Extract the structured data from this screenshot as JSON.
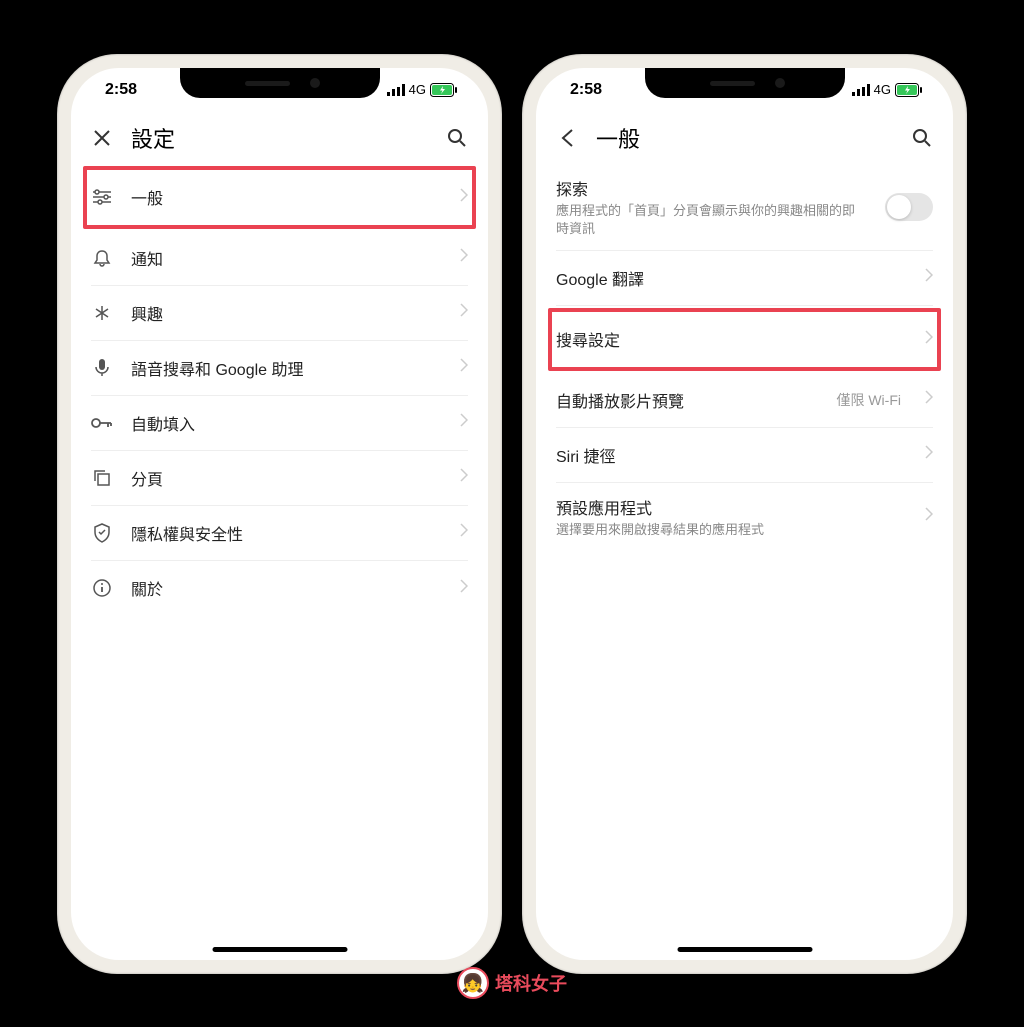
{
  "status": {
    "time": "2:58",
    "network": "4G"
  },
  "left": {
    "header": {
      "title": "設定"
    },
    "rows": [
      {
        "icon": "sliders",
        "label": "一般",
        "highlight": true
      },
      {
        "icon": "bell",
        "label": "通知"
      },
      {
        "icon": "star",
        "label": "興趣"
      },
      {
        "icon": "mic",
        "label": "語音搜尋和 Google 助理"
      },
      {
        "icon": "key",
        "label": "自動填入"
      },
      {
        "icon": "copy",
        "label": "分頁"
      },
      {
        "icon": "shield",
        "label": "隱私權與安全性"
      },
      {
        "icon": "info",
        "label": "關於"
      }
    ]
  },
  "right": {
    "header": {
      "title": "一般"
    },
    "rows": [
      {
        "label": "探索",
        "sub": "應用程式的「首頁」分頁會顯示與你的興趣相關的即時資訊",
        "toggle": true
      },
      {
        "label": "Google 翻譯"
      },
      {
        "label": "搜尋設定",
        "highlight": true
      },
      {
        "label": "自動播放影片預覽",
        "value": "僅限 Wi-Fi"
      },
      {
        "label": "Siri 捷徑"
      },
      {
        "label": "預設應用程式",
        "sub": "選擇要用來開啟搜尋結果的應用程式"
      }
    ]
  },
  "watermark": "塔科女子"
}
